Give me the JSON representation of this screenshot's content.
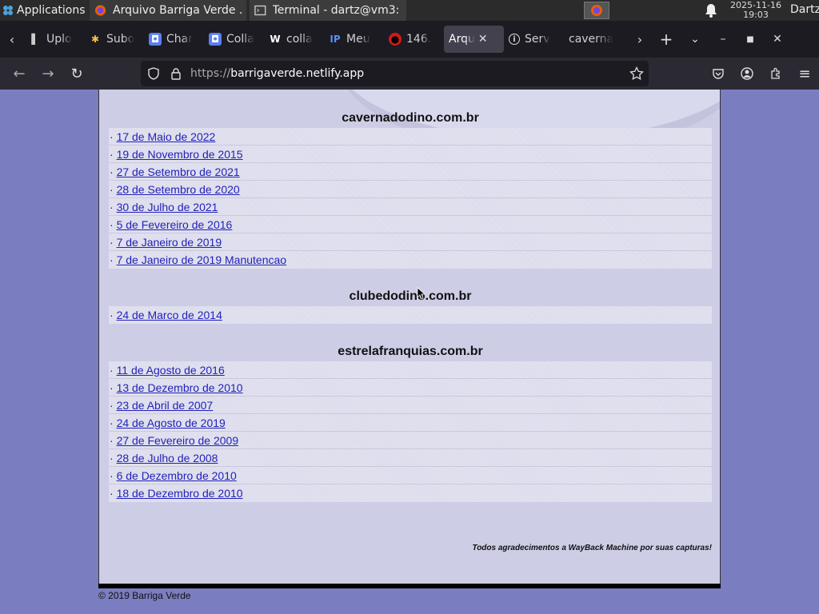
{
  "os": {
    "apps_label": "Applications",
    "tasks": [
      {
        "label": "Arquivo Barriga Verde ..."
      },
      {
        "label": "Terminal - dartz@vm3: ..."
      }
    ],
    "clock_date": "2025-11-16",
    "clock_time": "19:03",
    "user": "Dartz"
  },
  "browser": {
    "tabs": [
      {
        "label": "Uplo"
      },
      {
        "label": "Subo"
      },
      {
        "label": "Char"
      },
      {
        "label": "Colla"
      },
      {
        "label": "colla"
      },
      {
        "label": "Meu"
      },
      {
        "label": "146."
      },
      {
        "label": "Arqu",
        "selected": true
      },
      {
        "label": "Serv"
      },
      {
        "label": "caverna"
      }
    ],
    "url_proto": "https://",
    "url_host": "barrigaverde.netlify.app"
  },
  "page": {
    "sections": [
      {
        "title": "cavernadodino.com.br",
        "links": [
          "17 de Maio de 2022",
          "19 de Novembro de 2015",
          "27 de Setembro de 2021",
          "28 de Setembro de 2020",
          "30 de Julho de 2021",
          "5 de Fevereiro de 2016",
          "7 de Janeiro de 2019",
          "7 de Janeiro de 2019 Manutencao"
        ]
      },
      {
        "title": "clubedodino.com.br",
        "links": [
          "24 de Marco de 2014"
        ]
      },
      {
        "title": "estrelafranquias.com.br",
        "links": [
          "11 de Agosto de 2016",
          "13 de Dezembro de 2010",
          "23 de Abril de 2007",
          "24 de Agosto de 2019",
          "27 de Fevereiro de 2009",
          "28 de Julho de 2008",
          "6 de Dezembro de 2010",
          "18 de Dezembro de 2010"
        ]
      }
    ],
    "bullet": "·",
    "thanks": "Todos agradecimentos a WayBack Machine por suas capturas!",
    "copyright": "© 2019 Barriga Verde"
  }
}
